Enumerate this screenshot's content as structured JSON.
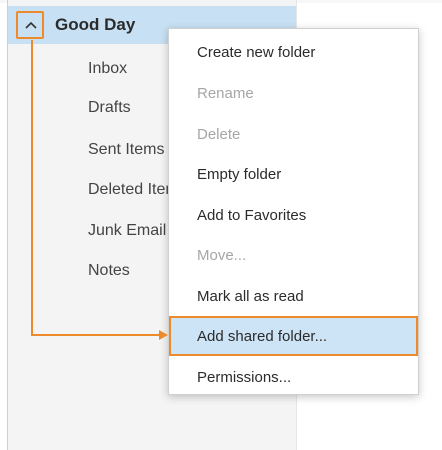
{
  "account": {
    "name": "Good Day",
    "expand_icon": "chevron-up-icon"
  },
  "folders": [
    {
      "label": "Inbox"
    },
    {
      "label": "Drafts"
    },
    {
      "label": "Sent Items"
    },
    {
      "label": "Deleted Items"
    },
    {
      "label": "Junk Email"
    },
    {
      "label": "Notes"
    }
  ],
  "context_menu": {
    "items": [
      {
        "label": "Create new folder",
        "enabled": true
      },
      {
        "label": "Rename",
        "enabled": false
      },
      {
        "label": "Delete",
        "enabled": false
      },
      {
        "label": "Empty folder",
        "enabled": true
      },
      {
        "label": "Add to Favorites",
        "enabled": true
      },
      {
        "label": "Move...",
        "enabled": false
      },
      {
        "label": "Mark all as read",
        "enabled": true
      },
      {
        "label": "Add shared folder...",
        "enabled": true,
        "highlighted": true
      },
      {
        "label": "Permissions...",
        "enabled": true
      }
    ]
  },
  "colors": {
    "highlight_orange": "#ed8b2c",
    "selection_blue": "#c7e0f4",
    "pane_background": "#f4f4f4"
  }
}
